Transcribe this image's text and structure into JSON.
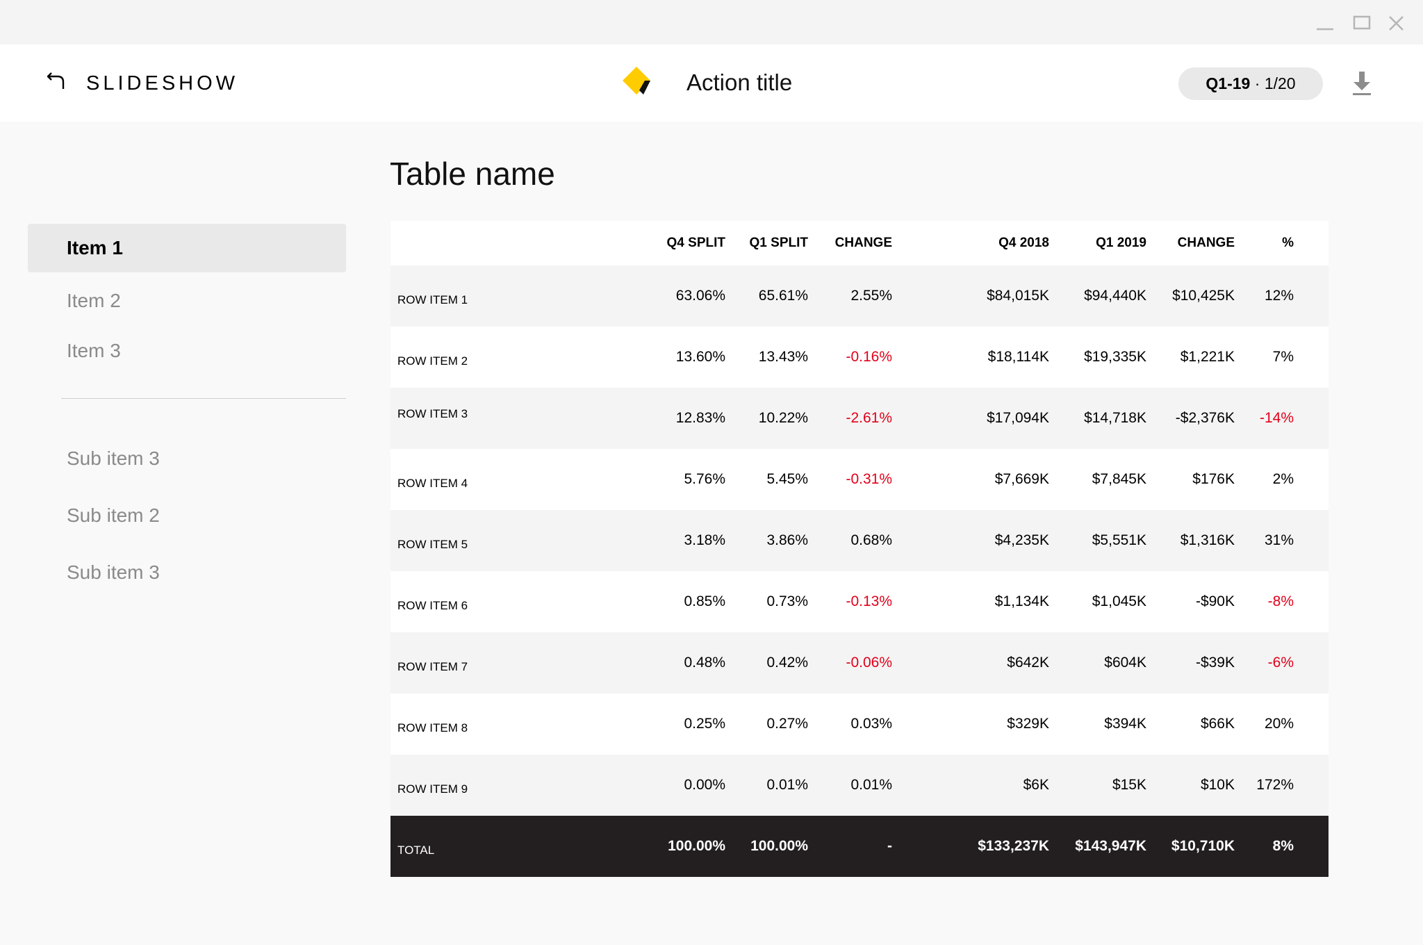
{
  "header": {
    "app_title": "SLIDESHOW",
    "action_title": "Action title",
    "period_label": "Q1-19",
    "period_separator": "·",
    "page_indicator": "1/20"
  },
  "sidebar": {
    "items": [
      {
        "label": "Item 1",
        "active": true
      },
      {
        "label": "Item 2",
        "active": false
      },
      {
        "label": "Item 3",
        "active": false
      }
    ],
    "sub_items": [
      {
        "label": "Sub item 3"
      },
      {
        "label": "Sub item 2"
      },
      {
        "label": "Sub item 3"
      }
    ]
  },
  "table": {
    "title": "Table name",
    "headers": [
      "",
      "Q4 SPLIT",
      "Q1 SPLIT",
      "CHANGE",
      "Q4 2018",
      "Q1 2019",
      "CHANGE",
      "%"
    ],
    "rows": [
      {
        "label": "ROW ITEM 1",
        "q4_split": "63.06%",
        "q1_split": "65.61%",
        "split_change": "2.55%",
        "q4_2018": "$84,015K",
        "q1_2019": "$94,440K",
        "value_change": "$10,425K",
        "pct": "12%"
      },
      {
        "label": "ROW ITEM 2",
        "q4_split": "13.60%",
        "q1_split": "13.43%",
        "split_change": "-0.16%",
        "q4_2018": "$18,114K",
        "q1_2019": "$19,335K",
        "value_change": "$1,221K",
        "pct": "7%"
      },
      {
        "label": "ROW ITEM 3",
        "q4_split": "12.83%",
        "q1_split": "10.22%",
        "split_change": "-2.61%",
        "q4_2018": "$17,094K",
        "q1_2019": "$14,718K",
        "value_change": "-$2,376K",
        "pct": "-14%"
      },
      {
        "label": "ROW ITEM 4",
        "q4_split": "5.76%",
        "q1_split": "5.45%",
        "split_change": "-0.31%",
        "q4_2018": "$7,669K",
        "q1_2019": "$7,845K",
        "value_change": "$176K",
        "pct": "2%"
      },
      {
        "label": "ROW ITEM 5",
        "q4_split": "3.18%",
        "q1_split": "3.86%",
        "split_change": "0.68%",
        "q4_2018": "$4,235K",
        "q1_2019": "$5,551K",
        "value_change": "$1,316K",
        "pct": "31%"
      },
      {
        "label": "ROW ITEM 6",
        "q4_split": "0.85%",
        "q1_split": "0.73%",
        "split_change": "-0.13%",
        "q4_2018": "$1,134K",
        "q1_2019": "$1,045K",
        "value_change": "-$90K",
        "pct": "-8%"
      },
      {
        "label": "ROW ITEM 7",
        "q4_split": "0.48%",
        "q1_split": "0.42%",
        "split_change": "-0.06%",
        "q4_2018": "$642K",
        "q1_2019": "$604K",
        "value_change": "-$39K",
        "pct": "-6%"
      },
      {
        "label": "ROW ITEM 8",
        "q4_split": "0.25%",
        "q1_split": "0.27%",
        "split_change": "0.03%",
        "q4_2018": "$329K",
        "q1_2019": "$394K",
        "value_change": "$66K",
        "pct": "20%"
      },
      {
        "label": "ROW ITEM 9",
        "q4_split": "0.00%",
        "q1_split": "0.01%",
        "split_change": "0.01%",
        "q4_2018": "$6K",
        "q1_2019": "$15K",
        "value_change": "$10K",
        "pct": "172%"
      }
    ],
    "total": {
      "label": "TOTAL",
      "q4_split": "100.00%",
      "q1_split": "100.00%",
      "split_change": "-",
      "q4_2018": "$133,237K",
      "q1_2019": "$143,947K",
      "value_change": "$10,710K",
      "pct": "8%"
    }
  },
  "colors": {
    "negative": "#e2001a",
    "brand_yellow": "#ffcc00",
    "total_row_bg": "#231f20",
    "active_item_bg": "#e9e9e9"
  },
  "icons": [
    "minimize-icon",
    "maximize-icon",
    "close-icon",
    "back-arrow-icon",
    "brand-logo-icon",
    "download-icon"
  ]
}
